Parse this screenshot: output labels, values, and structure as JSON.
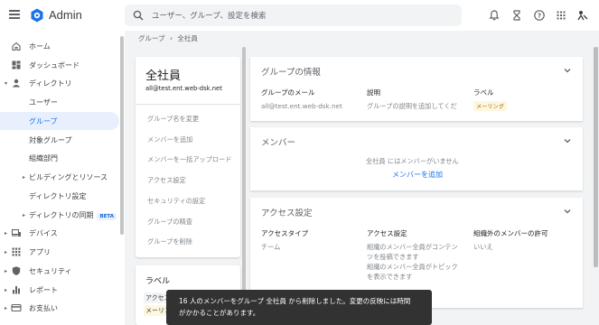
{
  "app": {
    "title": "Admin"
  },
  "search": {
    "placeholder": "ユーザー、グループ、設定を検索"
  },
  "sidebar": {
    "items": [
      {
        "label": "ホーム"
      },
      {
        "label": "ダッシュボード"
      },
      {
        "label": "ディレクトリ"
      },
      {
        "label": "ユーザー"
      },
      {
        "label": "グループ"
      },
      {
        "label": "対象グループ"
      },
      {
        "label": "組織部門"
      },
      {
        "label": "ビルディングとリソース"
      },
      {
        "label": "ディレクトリ設定"
      },
      {
        "label": "ディレクトリの同期",
        "badge": "BETA"
      },
      {
        "label": "デバイス"
      },
      {
        "label": "アプリ"
      },
      {
        "label": "セキュリティ"
      },
      {
        "label": "レポート"
      },
      {
        "label": "お支払い"
      }
    ]
  },
  "breadcrumb": {
    "parent": "グループ",
    "separator": "›",
    "current": "全社員"
  },
  "group": {
    "name": "全社員",
    "email": "all@test.ent.web-dsk.net",
    "actions": [
      "グループ名を変更",
      "メンバーを追加",
      "メンバーを一括アップロード",
      "アクセス設定",
      "セキュリティの設定",
      "グループの精査",
      "グループを削除"
    ]
  },
  "label_card": {
    "title": "ラベル",
    "label1": "アクセス",
    "label2": "メーリング"
  },
  "info_panel": {
    "title": "グループの情報",
    "email_header": "グループのメール",
    "email_value": "all@test.ent.web-dsk.net",
    "desc_header": "説明",
    "desc_value": "グループの説明を追加してくだ",
    "label_header": "ラベル",
    "label_value": "メーリング"
  },
  "members_panel": {
    "title": "メンバー",
    "empty_prefix": "全社員",
    "empty_text": "にはメンバーがいません",
    "add_link": "メンバーを追加"
  },
  "access_panel": {
    "title": "アクセス設定",
    "type_header": "アクセスタイプ",
    "type_value": "チーム",
    "setting_header": "アクセス設定",
    "setting_value_1": "組織のメンバー全員がコンテン",
    "setting_value_2": "ツを投稿できます",
    "setting_value_3": "組織のメンバー全員がトピック",
    "setting_value_4": "を表示できます",
    "external_header": "組織外のメンバーの許可",
    "external_value": "いいえ"
  },
  "snackbar": {
    "line1": "16 人のメンバーをグループ 全社員 から削除しました。変更の反映には時間",
    "line2": "がかかることがあります。"
  },
  "colors": {
    "accent": "#1a73e8",
    "active_bg": "#e8f0fe",
    "snackbar_bg": "#323232"
  }
}
